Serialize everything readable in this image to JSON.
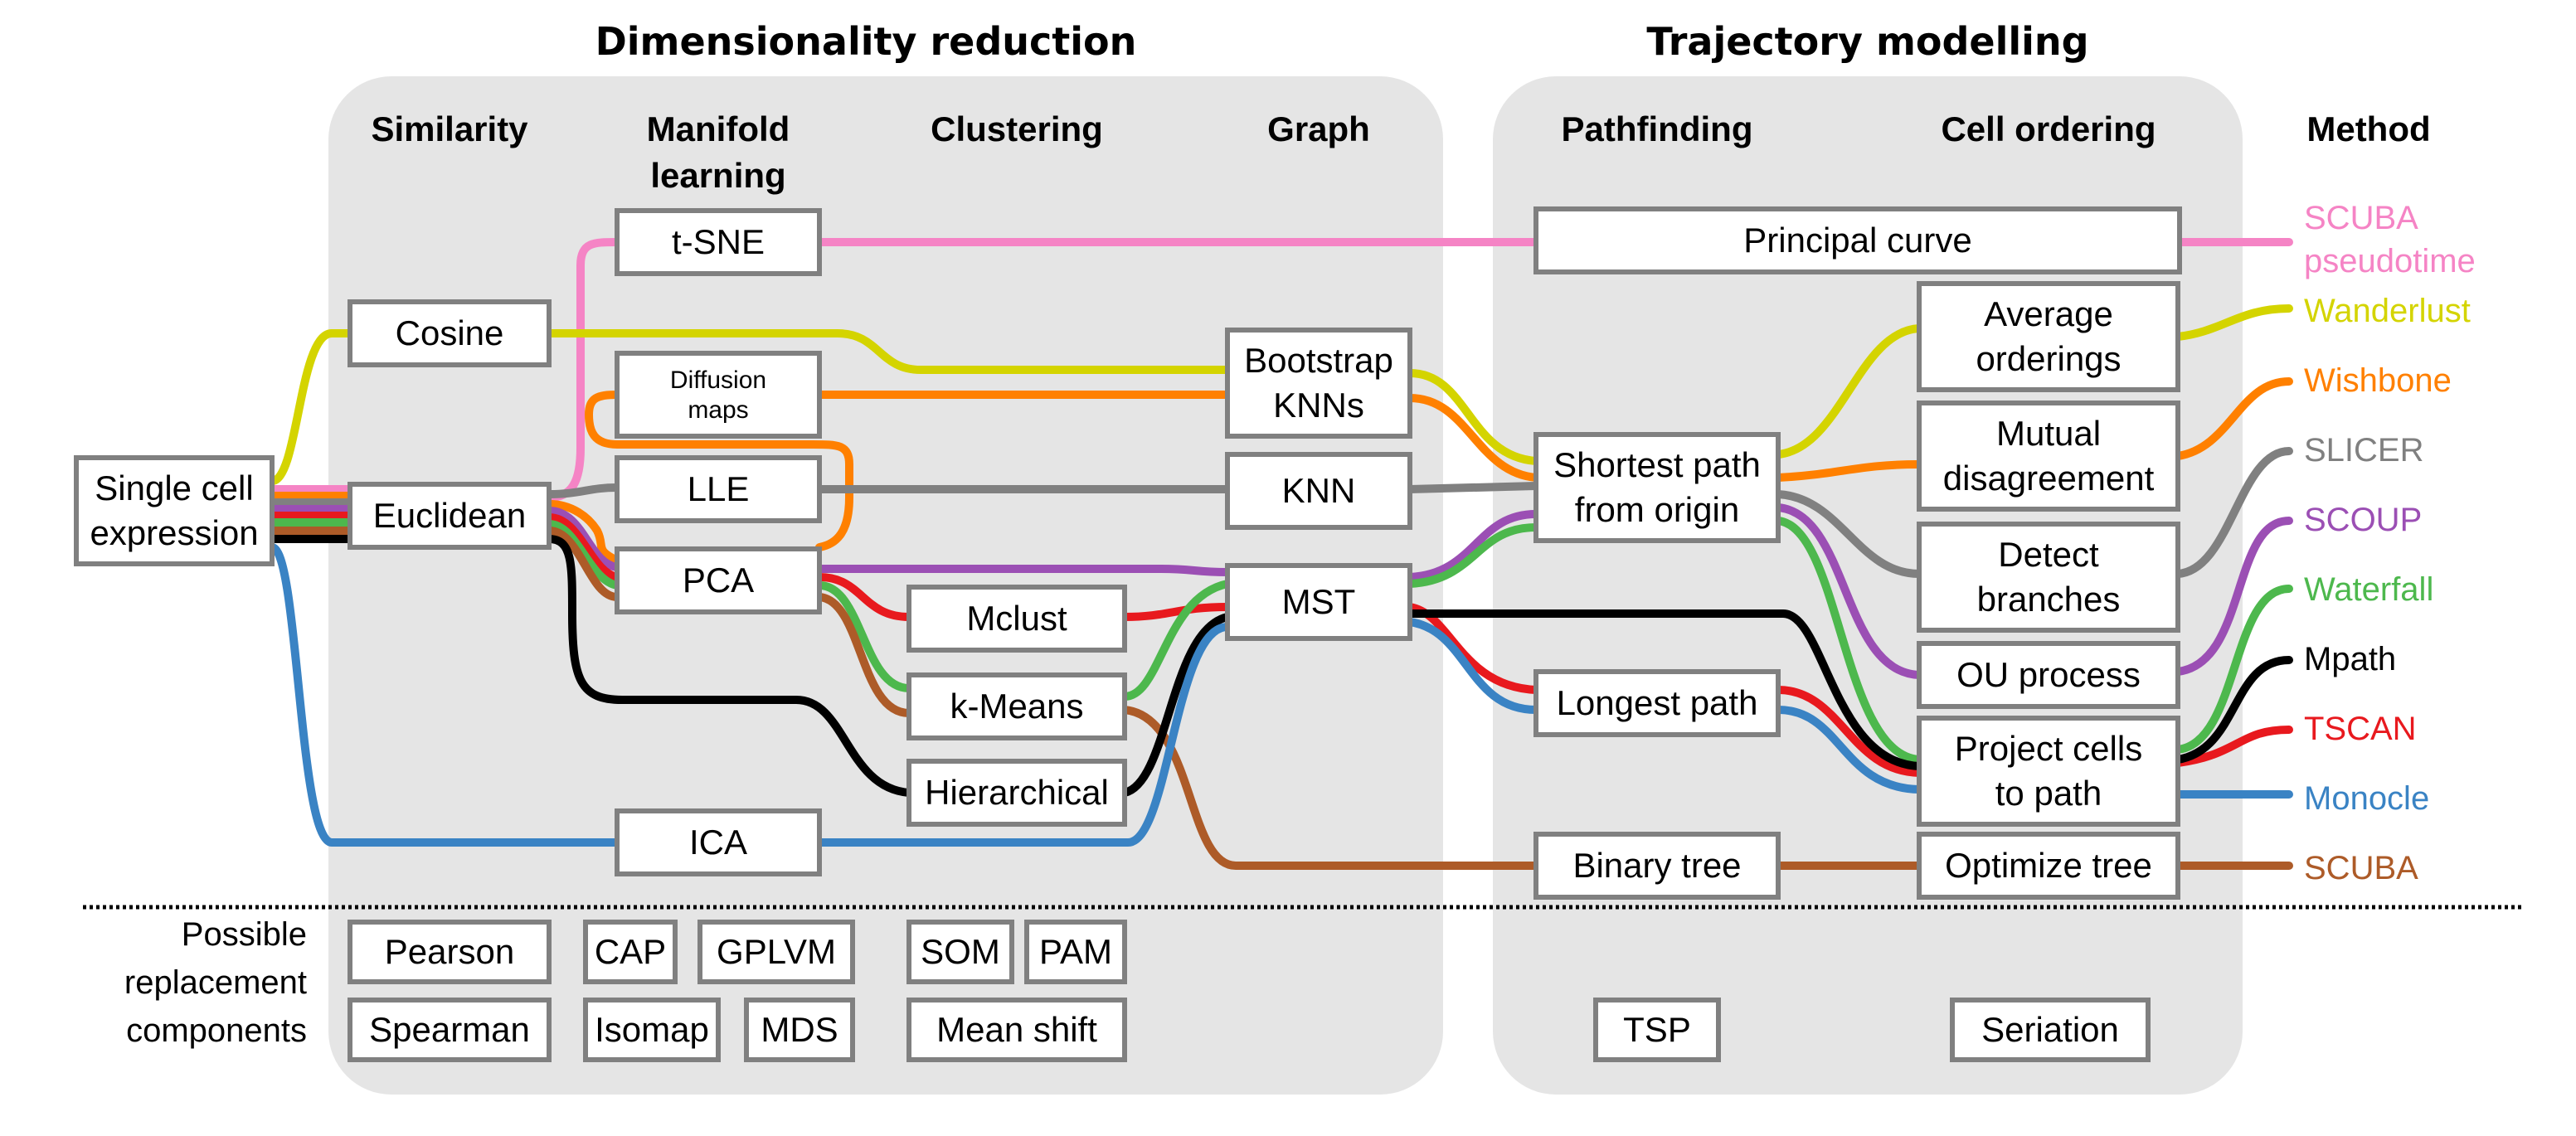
{
  "titles": {
    "dimensionality_reduction": "Dimensionality reduction",
    "trajectory_modelling": "Trajectory modelling"
  },
  "columns": {
    "similarity": "Similarity",
    "manifold_line1": "Manifold",
    "manifold_line2": "learning",
    "clustering": "Clustering",
    "graph": "Graph",
    "pathfinding": "Pathfinding",
    "cell_ordering": "Cell ordering",
    "method": "Method"
  },
  "nodes": {
    "single_cell": [
      "Single cell",
      "expression"
    ],
    "cosine": [
      "Cosine"
    ],
    "euclidean": [
      "Euclidean"
    ],
    "tsne": [
      "t-SNE"
    ],
    "diffusion": [
      "Diffusion",
      "maps"
    ],
    "lle": [
      "LLE"
    ],
    "pca": [
      "PCA"
    ],
    "ica": [
      "ICA"
    ],
    "mclust": [
      "Mclust"
    ],
    "kmeans": [
      "k-Means"
    ],
    "hierarchical": [
      "Hierarchical"
    ],
    "bootstrap": [
      "Bootstrap",
      "KNNs"
    ],
    "knn": [
      "KNN"
    ],
    "mst": [
      "MST"
    ],
    "principal_curve": [
      "Principal curve"
    ],
    "shortest_path": [
      "Shortest path",
      "from origin"
    ],
    "longest_path": [
      "Longest path"
    ],
    "binary_tree": [
      "Binary tree"
    ],
    "average_orderings": [
      "Average",
      "orderings"
    ],
    "mutual_disagreement": [
      "Mutual",
      "disagreement"
    ],
    "detect_branches": [
      "Detect",
      "branches"
    ],
    "ou_process": [
      "OU process"
    ],
    "project_cells": [
      "Project cells",
      "to path"
    ],
    "optimize_tree": [
      "Optimize tree"
    ]
  },
  "methods": [
    {
      "key": "scuba_pseudotime",
      "lines": [
        "SCUBA",
        "pseudotime"
      ],
      "color": "#f584c5"
    },
    {
      "key": "wanderlust",
      "lines": [
        "Wanderlust"
      ],
      "color": "#d4d400"
    },
    {
      "key": "wishbone",
      "lines": [
        "Wishbone"
      ],
      "color": "#ff8000"
    },
    {
      "key": "slicer",
      "lines": [
        "SLICER"
      ],
      "color": "#808080"
    },
    {
      "key": "scoup",
      "lines": [
        "SCOUP"
      ],
      "color": "#9b4fb4"
    },
    {
      "key": "waterfall",
      "lines": [
        "Waterfall"
      ],
      "color": "#4db84d"
    },
    {
      "key": "mpath",
      "lines": [
        "Mpath"
      ],
      "color": "#000000"
    },
    {
      "key": "tscan",
      "lines": [
        "TSCAN"
      ],
      "color": "#e8191e"
    },
    {
      "key": "monocle",
      "lines": [
        "Monocle"
      ],
      "color": "#3a83c4"
    },
    {
      "key": "scuba",
      "lines": [
        "SCUBA"
      ],
      "color": "#ad5b28"
    }
  ],
  "replacement": {
    "label": [
      "Possible",
      "replacement",
      "components"
    ],
    "similarity": [
      "Pearson",
      "Spearman"
    ],
    "manifold_row1": [
      "CAP",
      "GPLVM"
    ],
    "manifold_row2": [
      "Isomap",
      "MDS"
    ],
    "clustering_row1": [
      "SOM",
      "PAM"
    ],
    "clustering_row2": [
      "Mean shift"
    ],
    "pathfinding": [
      "TSP"
    ],
    "cell_ordering": [
      "Seriation"
    ]
  }
}
